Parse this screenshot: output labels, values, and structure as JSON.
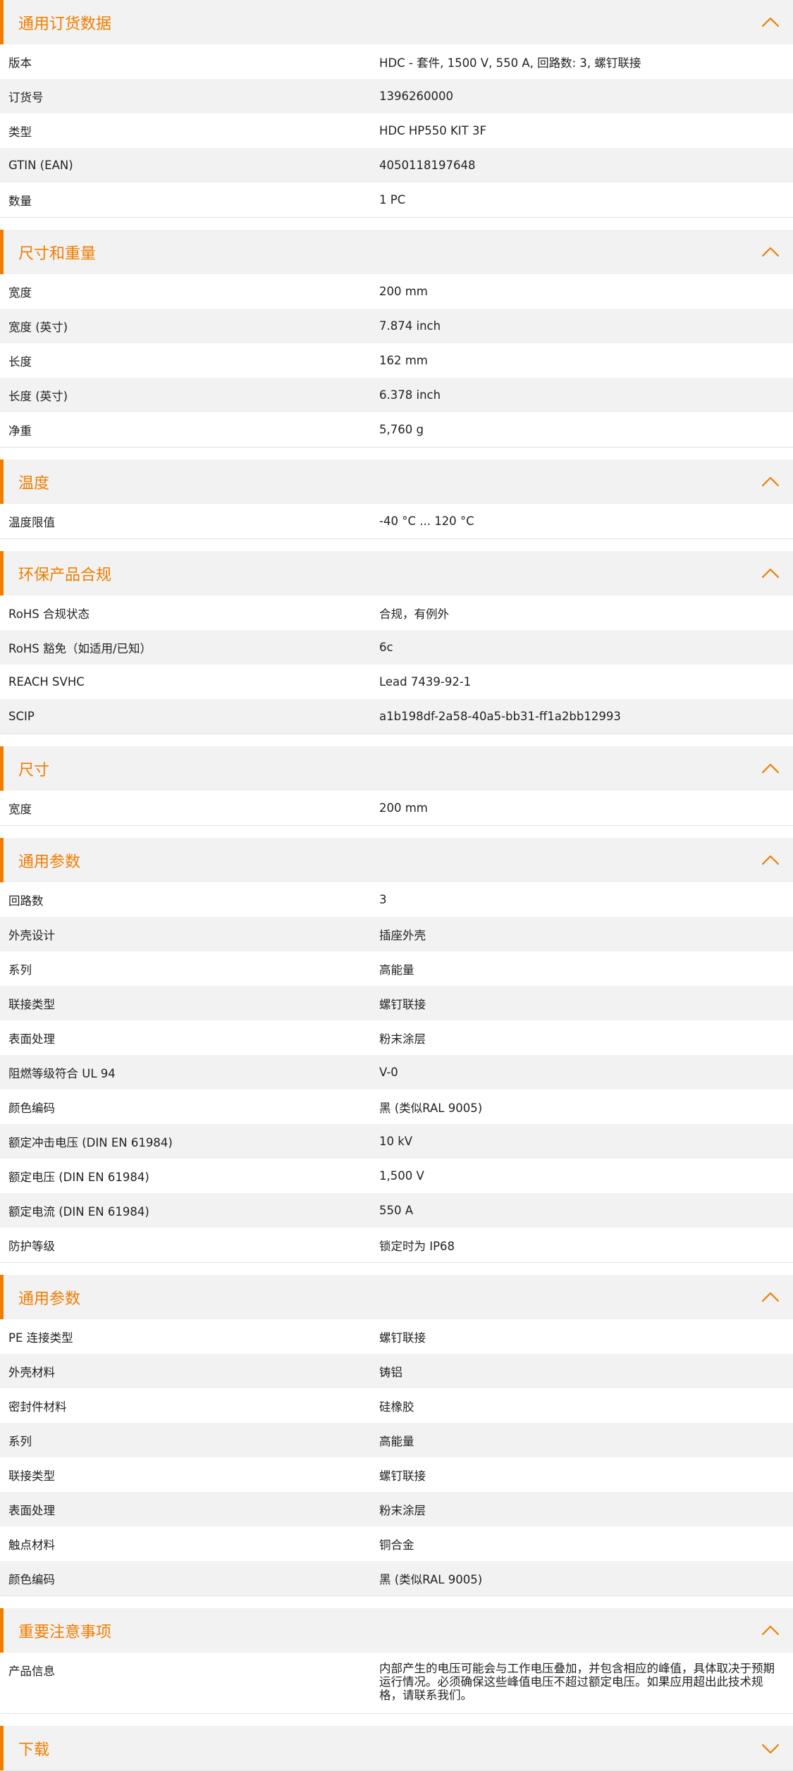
{
  "theme": {
    "accent_color": "#f07d00",
    "header_bg": "#f2f2f2",
    "row_alt_bg": "#f2f2f2"
  },
  "sections": [
    {
      "title": "通用订货数据",
      "icon": "chevron-up-icon",
      "rows": [
        {
          "label": "版本",
          "value": "HDC - 套件, 1500 V, 550 A, 回路数: 3, 螺钉联接"
        },
        {
          "label": "订货号",
          "value": "1396260000"
        },
        {
          "label": "类型",
          "value": "HDC HP550 KIT 3F"
        },
        {
          "label": "GTIN (EAN)",
          "value": "4050118197648"
        },
        {
          "label": "数量",
          "value": "1  PC"
        }
      ]
    },
    {
      "title": "尺寸和重量",
      "icon": "chevron-up-icon",
      "rows": [
        {
          "label": "宽度",
          "value": "200  mm"
        },
        {
          "label": "宽度 (英寸)",
          "value": "7.874  inch"
        },
        {
          "label": "长度",
          "value": "162  mm"
        },
        {
          "label": "长度 (英寸)",
          "value": "6.378  inch"
        },
        {
          "label": "净重",
          "value": "5,760  g"
        }
      ]
    },
    {
      "title": "温度",
      "icon": "chevron-up-icon",
      "rows": [
        {
          "label": "温度限值",
          "value": "-40 °C ... 120 °C"
        }
      ]
    },
    {
      "title": "环保产品合规",
      "icon": "chevron-up-icon",
      "rows": [
        {
          "label": "RoHS 合规状态",
          "value": "合规，有例外"
        },
        {
          "label": "RoHS 豁免（如适用/已知）",
          "value": "6c"
        },
        {
          "label": "REACH SVHC",
          "value": "Lead 7439-92-1"
        },
        {
          "label": "SCIP",
          "value": "a1b198df-2a58-40a5-bb31-ff1a2bb12993"
        }
      ]
    },
    {
      "title": "尺寸",
      "icon": "chevron-up-icon",
      "rows": [
        {
          "label": "宽度",
          "value": "200  mm"
        }
      ]
    },
    {
      "title": "通用参数",
      "icon": "chevron-up-icon",
      "rows": [
        {
          "label": "回路数",
          "value": "3"
        },
        {
          "label": "外壳设计",
          "value": "插座外壳"
        },
        {
          "label": "系列",
          "value": "高能量"
        },
        {
          "label": "联接类型",
          "value": "螺钉联接"
        },
        {
          "label": "表面处理",
          "value": "粉末涂层"
        },
        {
          "label": "阻燃等级符合 UL 94",
          "value": "V-0"
        },
        {
          "label": "颜色编码",
          "value": "黑 (类似RAL 9005)"
        },
        {
          "label": "额定冲击电压 (DIN EN 61984)",
          "value": "10  kV"
        },
        {
          "label": "额定电压 (DIN EN 61984)",
          "value": "1,500  V"
        },
        {
          "label": "额定电流 (DIN EN 61984)",
          "value": "550  A"
        },
        {
          "label": "防护等级",
          "value": "锁定时为 IP68"
        }
      ]
    },
    {
      "title": "通用参数",
      "icon": "chevron-up-icon",
      "rows": [
        {
          "label": "PE 连接类型",
          "value": "螺钉联接"
        },
        {
          "label": "外壳材料",
          "value": "铸铝"
        },
        {
          "label": "密封件材料",
          "value": "硅橡胶"
        },
        {
          "label": "系列",
          "value": "高能量"
        },
        {
          "label": "联接类型",
          "value": "螺钉联接"
        },
        {
          "label": "表面处理",
          "value": "粉末涂层"
        },
        {
          "label": "触点材料",
          "value": "铜合金"
        },
        {
          "label": "颜色编码",
          "value": "黑 (类似RAL 9005)"
        }
      ]
    },
    {
      "title": "重要注意事项",
      "icon": "chevron-up-icon",
      "rows": [
        {
          "label": "产品信息",
          "value": "内部产生的电压可能会与工作电压叠加，并包含相应的峰值，具体取决于预期运行情况。必须确保这些峰值电压不超过额定电压。如果应用超出此技术规格，请联系我们。",
          "tall": true
        }
      ]
    },
    {
      "title": "下载",
      "icon": "chevron-down-icon",
      "rows": []
    }
  ]
}
